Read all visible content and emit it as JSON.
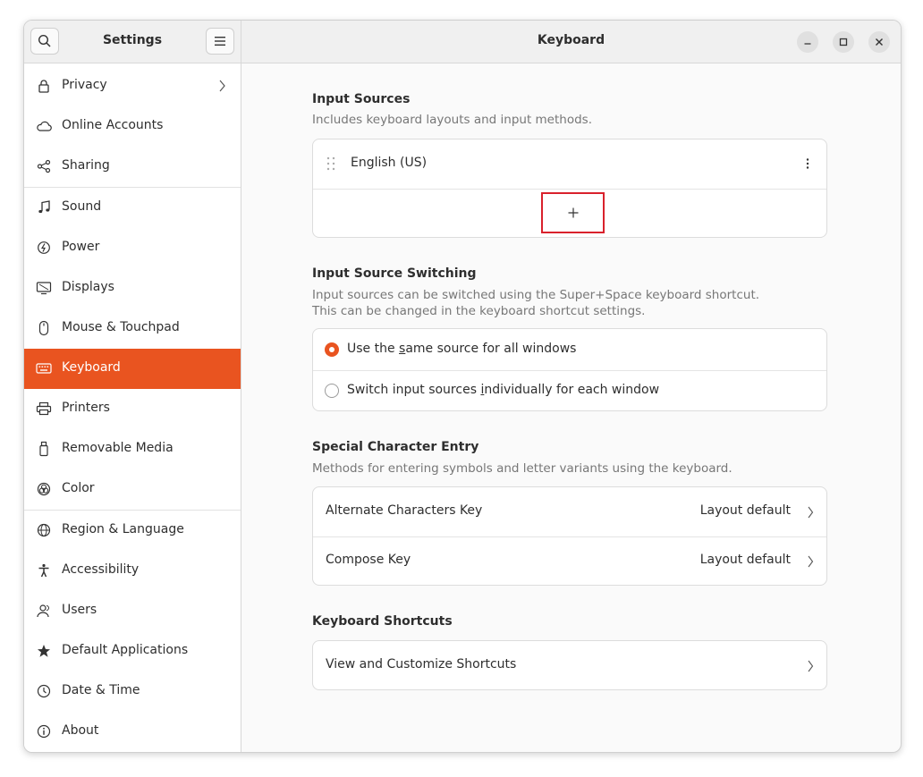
{
  "sidebar": {
    "title": "Settings",
    "search_icon": "search-icon",
    "menu_icon": "hamburger-menu-icon",
    "items": [
      {
        "label": "Privacy",
        "icon": "lock-icon"
      },
      {
        "label": "Online Accounts",
        "icon": "cloud-icon"
      },
      {
        "label": "Sharing",
        "icon": "share-icon"
      },
      {
        "label": "Sound",
        "icon": "music-note-icon"
      },
      {
        "label": "Power",
        "icon": "power-icon"
      },
      {
        "label": "Displays",
        "icon": "display-icon"
      },
      {
        "label": "Mouse & Touchpad",
        "icon": "mouse-icon"
      },
      {
        "label": "Keyboard",
        "icon": "keyboard-icon"
      },
      {
        "label": "Printers",
        "icon": "printer-icon"
      },
      {
        "label": "Removable Media",
        "icon": "usb-drive-icon"
      },
      {
        "label": "Color",
        "icon": "color-icon"
      },
      {
        "label": "Region & Language",
        "icon": "globe-icon"
      },
      {
        "label": "Accessibility",
        "icon": "accessibility-icon"
      },
      {
        "label": "Users",
        "icon": "users-icon"
      },
      {
        "label": "Default Applications",
        "icon": "star-icon"
      },
      {
        "label": "Date & Time",
        "icon": "clock-icon"
      },
      {
        "label": "About",
        "icon": "info-icon"
      }
    ],
    "active": "Keyboard"
  },
  "header": {
    "title": "Keyboard"
  },
  "input_sources": {
    "title": "Input Sources",
    "subtitle": "Includes keyboard layouts and input methods.",
    "sources": [
      {
        "label": "English (US)"
      }
    ],
    "add_label": "+"
  },
  "switching": {
    "title": "Input Source Switching",
    "subtitle_line1": "Input sources can be switched using the Super+Space keyboard shortcut.",
    "subtitle_line2": "This can be changed in the keyboard shortcut settings.",
    "option1_a": "Use the ",
    "option1_u": "s",
    "option1_b": "ame source for all windows",
    "option2_a": "Switch input sources ",
    "option2_u": "i",
    "option2_b": "ndividually for each window",
    "selected": 0
  },
  "special": {
    "title": "Special Character Entry",
    "subtitle": "Methods for entering symbols and letter variants using the keyboard.",
    "rows": [
      {
        "label": "Alternate Characters Key",
        "value": "Layout default"
      },
      {
        "label": "Compose Key",
        "value": "Layout default"
      }
    ]
  },
  "shortcuts": {
    "title": "Keyboard Shortcuts",
    "row_label": "View and Customize Shortcuts"
  },
  "colors": {
    "accent": "#e95420",
    "highlight_box": "#d9212c"
  }
}
